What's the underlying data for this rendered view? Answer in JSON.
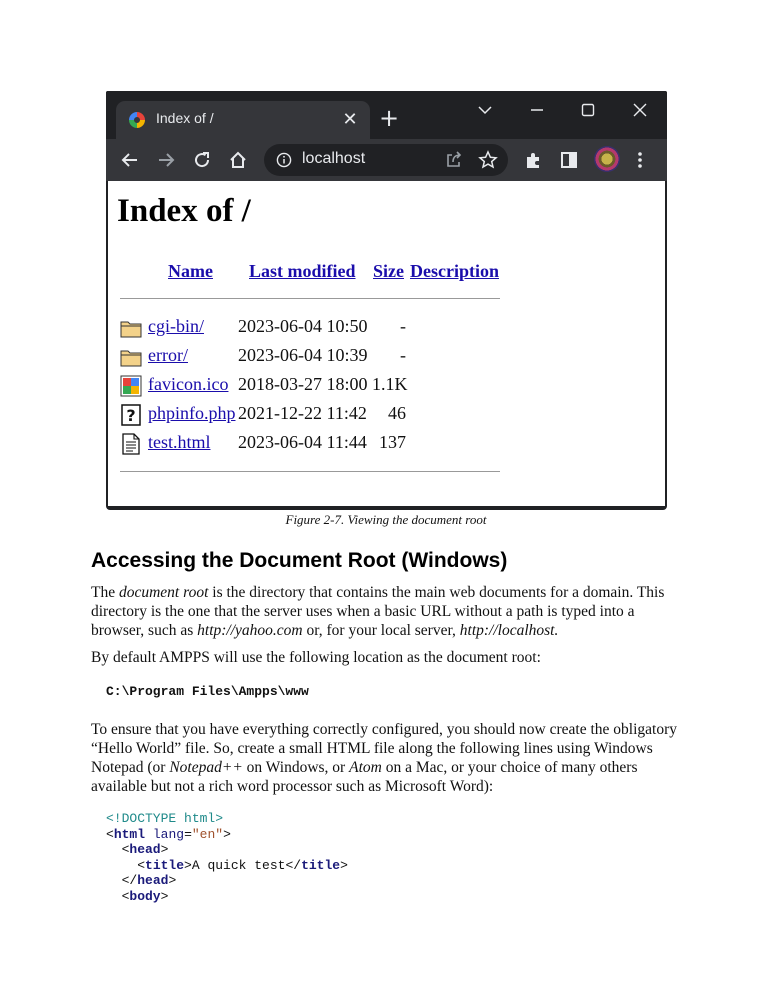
{
  "browser": {
    "tab_title": "Index of /",
    "url": "localhost",
    "icons": {
      "tab_close": "close-icon",
      "new_tab": "plus-icon",
      "tab_search": "chevron-down-icon",
      "minimize": "minimize-icon",
      "maximize": "maximize-icon",
      "window_close": "close-icon",
      "back": "arrow-left-icon",
      "forward": "arrow-right-icon",
      "reload": "reload-icon",
      "home": "home-icon",
      "info": "info-icon",
      "share": "share-icon",
      "bookmark": "star-icon",
      "extensions": "puzzle-icon",
      "side_panel": "side-panel-icon",
      "profile": "avatar",
      "menu": "kebab-menu-icon"
    },
    "colors": {
      "frame": "#202124",
      "toolbar": "#35363a",
      "link": "#1a0dab"
    }
  },
  "page": {
    "heading": "Index of /",
    "columns": {
      "name": "Name",
      "last_modified": "Last modified",
      "size": "Size",
      "description": "Description"
    },
    "rows": [
      {
        "icon": "folder-icon",
        "name": "cgi-bin/",
        "modified": "2023-06-04 10:50",
        "size": "-"
      },
      {
        "icon": "folder-icon",
        "name": "error/",
        "modified": "2023-06-04 10:39",
        "size": "-"
      },
      {
        "icon": "image-icon",
        "name": "favicon.ico",
        "modified": "2018-03-27 18:00",
        "size": "1.1K"
      },
      {
        "icon": "unknown-file-icon",
        "name": "phpinfo.php",
        "modified": "2021-12-22 11:42",
        "size": "46"
      },
      {
        "icon": "text-file-icon",
        "name": "test.html",
        "modified": "2023-06-04 11:44",
        "size": "137"
      }
    ]
  },
  "doc": {
    "caption": "Figure 2-7. Viewing the document root",
    "section_heading": "Accessing the Document Root (Windows)",
    "p1": {
      "t1": "The ",
      "em1": "document root",
      "t2": " is the directory that contains the main web documents for a domain. This directory is the one that the server uses when a basic URL without a path is typed into a browser, such as ",
      "em2": "http://yahoo.com",
      "t3": " or, for your local server, ",
      "em3": "http://localhost."
    },
    "p2": "By default AMPPS will use the following location as the document root:",
    "path_code": "C:\\Program Files\\Ampps\\www",
    "p3": {
      "t1": "To ensure that you have everything correctly configured, you should now create the obligatory “Hello World” file. So, create a small HTML file along the following lines using Windows Notepad (or ",
      "em1": "Notepad++",
      "t2": " on Windows, or ",
      "em2": "Atom",
      "t3": " on a Mac, or your choice of many others available  but not a rich word processor such as Microsoft Word):"
    },
    "code": {
      "doctype": "<!DOCTYPE html>",
      "html_tag": "html",
      "lang_attr": "lang",
      "lang_val": "\"en\"",
      "head_tag": "head",
      "title_tag": "title",
      "title_text": "A quick test",
      "body_tag": "body"
    }
  }
}
